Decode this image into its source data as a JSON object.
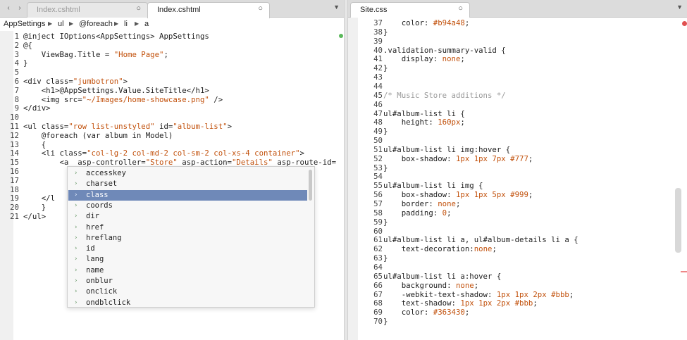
{
  "left": {
    "nav": {
      "back": "‹",
      "forward": "›"
    },
    "tabs": [
      {
        "label": "Index.cshtml",
        "close": "○"
      },
      {
        "label": "Index.cshtml",
        "close": "○"
      }
    ],
    "dropdown": "▼",
    "breadcrumbs": [
      "AppSettings",
      "ul",
      "@foreach",
      "li",
      "a"
    ],
    "breadcrumb_sep": "▶",
    "lines": [
      {
        "n": "1",
        "segs": [
          {
            "t": "@inject IOptions<AppSettings> AppSettings"
          }
        ]
      },
      {
        "n": "2",
        "segs": [
          {
            "t": "@{"
          }
        ]
      },
      {
        "n": "3",
        "segs": [
          {
            "t": "    ViewBag.Title = "
          },
          {
            "t": "\"Home Page\"",
            "k": "s"
          },
          {
            "t": ";"
          }
        ]
      },
      {
        "n": "4",
        "segs": [
          {
            "t": "}"
          }
        ]
      },
      {
        "n": "5",
        "segs": [
          {
            "t": ""
          }
        ]
      },
      {
        "n": "6",
        "segs": [
          {
            "t": "<div class="
          },
          {
            "t": "\"jumbotron\"",
            "k": "s"
          },
          {
            "t": ">"
          }
        ]
      },
      {
        "n": "7",
        "segs": [
          {
            "t": "    <h1>@AppSettings.Value.SiteTitle</h1>"
          }
        ]
      },
      {
        "n": "8",
        "segs": [
          {
            "t": "    <img src="
          },
          {
            "t": "\"~/Images/home-showcase.png\"",
            "k": "s"
          },
          {
            "t": " />"
          }
        ]
      },
      {
        "n": "9",
        "segs": [
          {
            "t": "</div>"
          }
        ]
      },
      {
        "n": "10",
        "segs": [
          {
            "t": ""
          }
        ]
      },
      {
        "n": "11",
        "segs": [
          {
            "t": "<ul class="
          },
          {
            "t": "\"row list-unstyled\"",
            "k": "s"
          },
          {
            "t": " id="
          },
          {
            "t": "\"album-list\"",
            "k": "s"
          },
          {
            "t": ">"
          }
        ]
      },
      {
        "n": "12",
        "segs": [
          {
            "t": "    @foreach (var album in Model)"
          }
        ]
      },
      {
        "n": "13",
        "segs": [
          {
            "t": "    {"
          }
        ]
      },
      {
        "n": "14",
        "segs": [
          {
            "t": "    <li class="
          },
          {
            "t": "\"col-lg-2 col-md-2 col-sm-2 col-xs-4 container\"",
            "k": "s"
          },
          {
            "t": ">"
          }
        ]
      },
      {
        "n": "15",
        "segs": [
          {
            "t": "        <a  asp-controller="
          },
          {
            "t": "\"Store\"",
            "k": "s"
          },
          {
            "t": " asp-action="
          },
          {
            "t": "\"Details\"",
            "k": "s"
          },
          {
            "t": " asp-route-id="
          }
        ]
      },
      {
        "n": "16",
        "segs": [
          {
            "t": "                                                        "
          },
          {
            "t": "umArt",
            "k": "s"
          }
        ]
      },
      {
        "n": "17",
        "segs": [
          {
            "t": ""
          }
        ]
      },
      {
        "n": "18",
        "segs": [
          {
            "t": ""
          }
        ]
      },
      {
        "n": "19",
        "segs": [
          {
            "t": "    </l"
          }
        ]
      },
      {
        "n": "20",
        "segs": [
          {
            "t": "    }"
          }
        ]
      },
      {
        "n": "21",
        "segs": [
          {
            "t": "</ul>"
          }
        ]
      }
    ],
    "autocomplete": {
      "chevron": "›",
      "selected": 2,
      "items": [
        "accesskey",
        "charset",
        "class",
        "coords",
        "dir",
        "href",
        "hreflang",
        "id",
        "lang",
        "name",
        "onblur",
        "onclick",
        "ondblclick"
      ]
    }
  },
  "right": {
    "tab": {
      "label": "Site.css",
      "close": "○"
    },
    "dropdown": "▼",
    "lines": [
      {
        "n": "37",
        "segs": [
          {
            "t": "    color: "
          },
          {
            "t": "#b94a48",
            "k": "n"
          },
          {
            "t": ";"
          }
        ]
      },
      {
        "n": "38",
        "segs": [
          {
            "t": "}"
          }
        ]
      },
      {
        "n": "39",
        "segs": [
          {
            "t": ""
          }
        ]
      },
      {
        "n": "40",
        "segs": [
          {
            "t": ".validation-summary-valid {"
          }
        ]
      },
      {
        "n": "41",
        "segs": [
          {
            "t": "    display: "
          },
          {
            "t": "none",
            "k": "n"
          },
          {
            "t": ";"
          }
        ]
      },
      {
        "n": "42",
        "segs": [
          {
            "t": "}"
          }
        ]
      },
      {
        "n": "43",
        "segs": [
          {
            "t": ""
          }
        ]
      },
      {
        "n": "44",
        "segs": [
          {
            "t": ""
          }
        ]
      },
      {
        "n": "45",
        "segs": [
          {
            "t": "/* Music Store additions */",
            "k": "c"
          }
        ]
      },
      {
        "n": "46",
        "segs": [
          {
            "t": ""
          }
        ]
      },
      {
        "n": "47",
        "segs": [
          {
            "t": "ul#album-list li {"
          }
        ]
      },
      {
        "n": "48",
        "segs": [
          {
            "t": "    height: "
          },
          {
            "t": "160px",
            "k": "n"
          },
          {
            "t": ";"
          }
        ]
      },
      {
        "n": "49",
        "segs": [
          {
            "t": "}"
          }
        ]
      },
      {
        "n": "50",
        "segs": [
          {
            "t": ""
          }
        ]
      },
      {
        "n": "51",
        "segs": [
          {
            "t": "ul#album-list li img:hover {"
          }
        ]
      },
      {
        "n": "52",
        "segs": [
          {
            "t": "    box-shadow: "
          },
          {
            "t": "1px 1px 7px #777",
            "k": "n"
          },
          {
            "t": ";"
          }
        ]
      },
      {
        "n": "53",
        "segs": [
          {
            "t": "}"
          }
        ]
      },
      {
        "n": "54",
        "segs": [
          {
            "t": ""
          }
        ]
      },
      {
        "n": "55",
        "segs": [
          {
            "t": "ul#album-list li img {"
          }
        ]
      },
      {
        "n": "56",
        "segs": [
          {
            "t": "    box-shadow: "
          },
          {
            "t": "1px 1px 5px #999",
            "k": "n"
          },
          {
            "t": ";"
          }
        ]
      },
      {
        "n": "57",
        "segs": [
          {
            "t": "    border: "
          },
          {
            "t": "none",
            "k": "n"
          },
          {
            "t": ";"
          }
        ]
      },
      {
        "n": "58",
        "segs": [
          {
            "t": "    padding: "
          },
          {
            "t": "0",
            "k": "n"
          },
          {
            "t": ";"
          }
        ]
      },
      {
        "n": "59",
        "segs": [
          {
            "t": "}"
          }
        ]
      },
      {
        "n": "60",
        "segs": [
          {
            "t": ""
          }
        ]
      },
      {
        "n": "61",
        "segs": [
          {
            "t": "ul#album-list li a, ul#album-details li a {"
          }
        ]
      },
      {
        "n": "62",
        "segs": [
          {
            "t": "    text-decoration:"
          },
          {
            "t": "none",
            "k": "n"
          },
          {
            "t": ";"
          }
        ]
      },
      {
        "n": "63",
        "segs": [
          {
            "t": "}"
          }
        ]
      },
      {
        "n": "64",
        "segs": [
          {
            "t": ""
          }
        ]
      },
      {
        "n": "65",
        "segs": [
          {
            "t": "ul#album-list li a:hover {"
          }
        ]
      },
      {
        "n": "66",
        "segs": [
          {
            "t": "    background: "
          },
          {
            "t": "none",
            "k": "n"
          },
          {
            "t": ";"
          }
        ]
      },
      {
        "n": "67",
        "segs": [
          {
            "t": "    -webkit-text-shadow: "
          },
          {
            "t": "1px 1px 2px #bbb",
            "k": "n"
          },
          {
            "t": ";"
          }
        ]
      },
      {
        "n": "68",
        "segs": [
          {
            "t": "    text-shadow: "
          },
          {
            "t": "1px 1px 2px #bbb",
            "k": "n"
          },
          {
            "t": ";"
          }
        ]
      },
      {
        "n": "69",
        "segs": [
          {
            "t": "    color: "
          },
          {
            "t": "#363430",
            "k": "n"
          },
          {
            "t": ";"
          }
        ]
      },
      {
        "n": "70",
        "segs": [
          {
            "t": "}"
          }
        ]
      }
    ]
  }
}
